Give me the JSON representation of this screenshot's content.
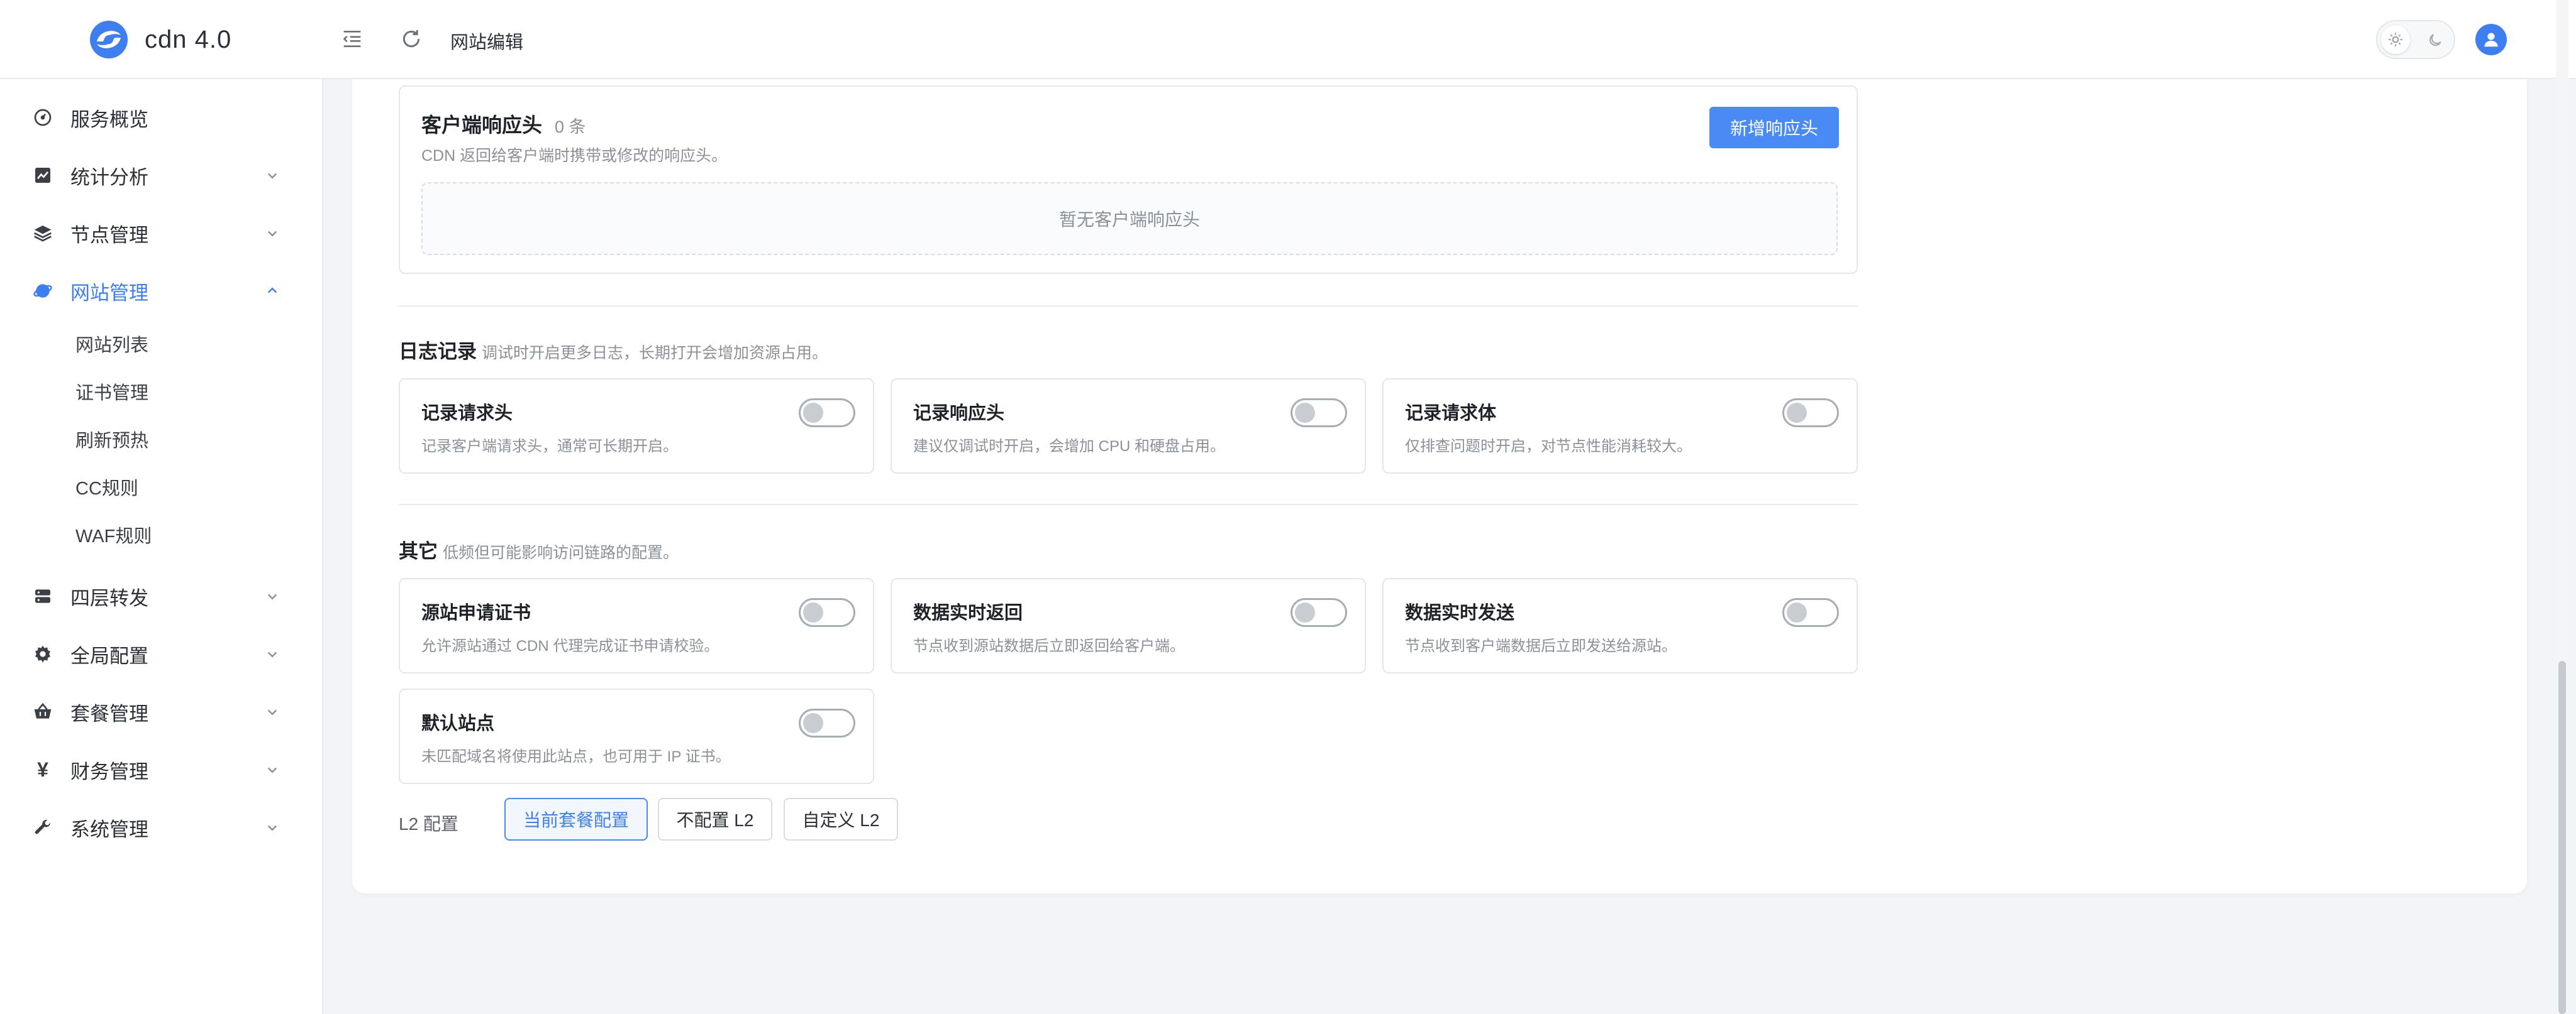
{
  "app": {
    "name": "cdn 4.0",
    "page_title": "网站编辑"
  },
  "colors": {
    "accent": "#3d7ff1",
    "primary_button": "#4a8af4",
    "text": "#1f2329",
    "muted": "#8b9099"
  },
  "sidebar": {
    "items": [
      {
        "label": "服务概览",
        "icon": "dashboard-icon",
        "has_children": false
      },
      {
        "label": "统计分析",
        "icon": "chart-icon",
        "has_children": true
      },
      {
        "label": "节点管理",
        "icon": "layers-icon",
        "has_children": true
      },
      {
        "label": "网站管理",
        "icon": "globe-icon",
        "has_children": true,
        "expanded": true,
        "active": true
      },
      {
        "label": "四层转发",
        "icon": "server-icon",
        "has_children": true
      },
      {
        "label": "全局配置",
        "icon": "gear-icon",
        "has_children": true
      },
      {
        "label": "套餐管理",
        "icon": "basket-icon",
        "has_children": true
      },
      {
        "label": "财务管理",
        "icon": "yen-icon",
        "has_children": true
      },
      {
        "label": "系统管理",
        "icon": "wrench-icon",
        "has_children": true
      }
    ],
    "subitems": [
      "网站列表",
      "证书管理",
      "刷新预热",
      "CC规则",
      "WAF规则"
    ]
  },
  "response_headers": {
    "title": "客户端响应头",
    "count": "0 条",
    "description": "CDN 返回给客户端时携带或修改的响应头。",
    "add_button": "新增响应头",
    "empty_text": "暂无客户端响应头"
  },
  "logging": {
    "title": "日志记录",
    "description": "调试时开启更多日志，长期打开会增加资源占用。",
    "options": [
      {
        "title": "记录请求头",
        "description": "记录客户端请求头，通常可长期开启。",
        "enabled": false
      },
      {
        "title": "记录响应头",
        "description": "建议仅调试时开启，会增加 CPU 和硬盘占用。",
        "enabled": false
      },
      {
        "title": "记录请求体",
        "description": "仅排查问题时开启，对节点性能消耗较大。",
        "enabled": false
      }
    ]
  },
  "other": {
    "title": "其它",
    "description": "低频但可能影响访问链路的配置。",
    "options": [
      {
        "title": "源站申请证书",
        "description": "允许源站通过 CDN 代理完成证书申请校验。",
        "enabled": false
      },
      {
        "title": "数据实时返回",
        "description": "节点收到源站数据后立即返回给客户端。",
        "enabled": false
      },
      {
        "title": "数据实时发送",
        "description": "节点收到客户端数据后立即发送给源站。",
        "enabled": false
      },
      {
        "title": "默认站点",
        "description": "未匹配域名将使用此站点，也可用于 IP 证书。",
        "enabled": false
      }
    ]
  },
  "l2": {
    "label": "L2 配置",
    "options": [
      "当前套餐配置",
      "不配置 L2",
      "自定义 L2"
    ],
    "selected": "当前套餐配置"
  }
}
